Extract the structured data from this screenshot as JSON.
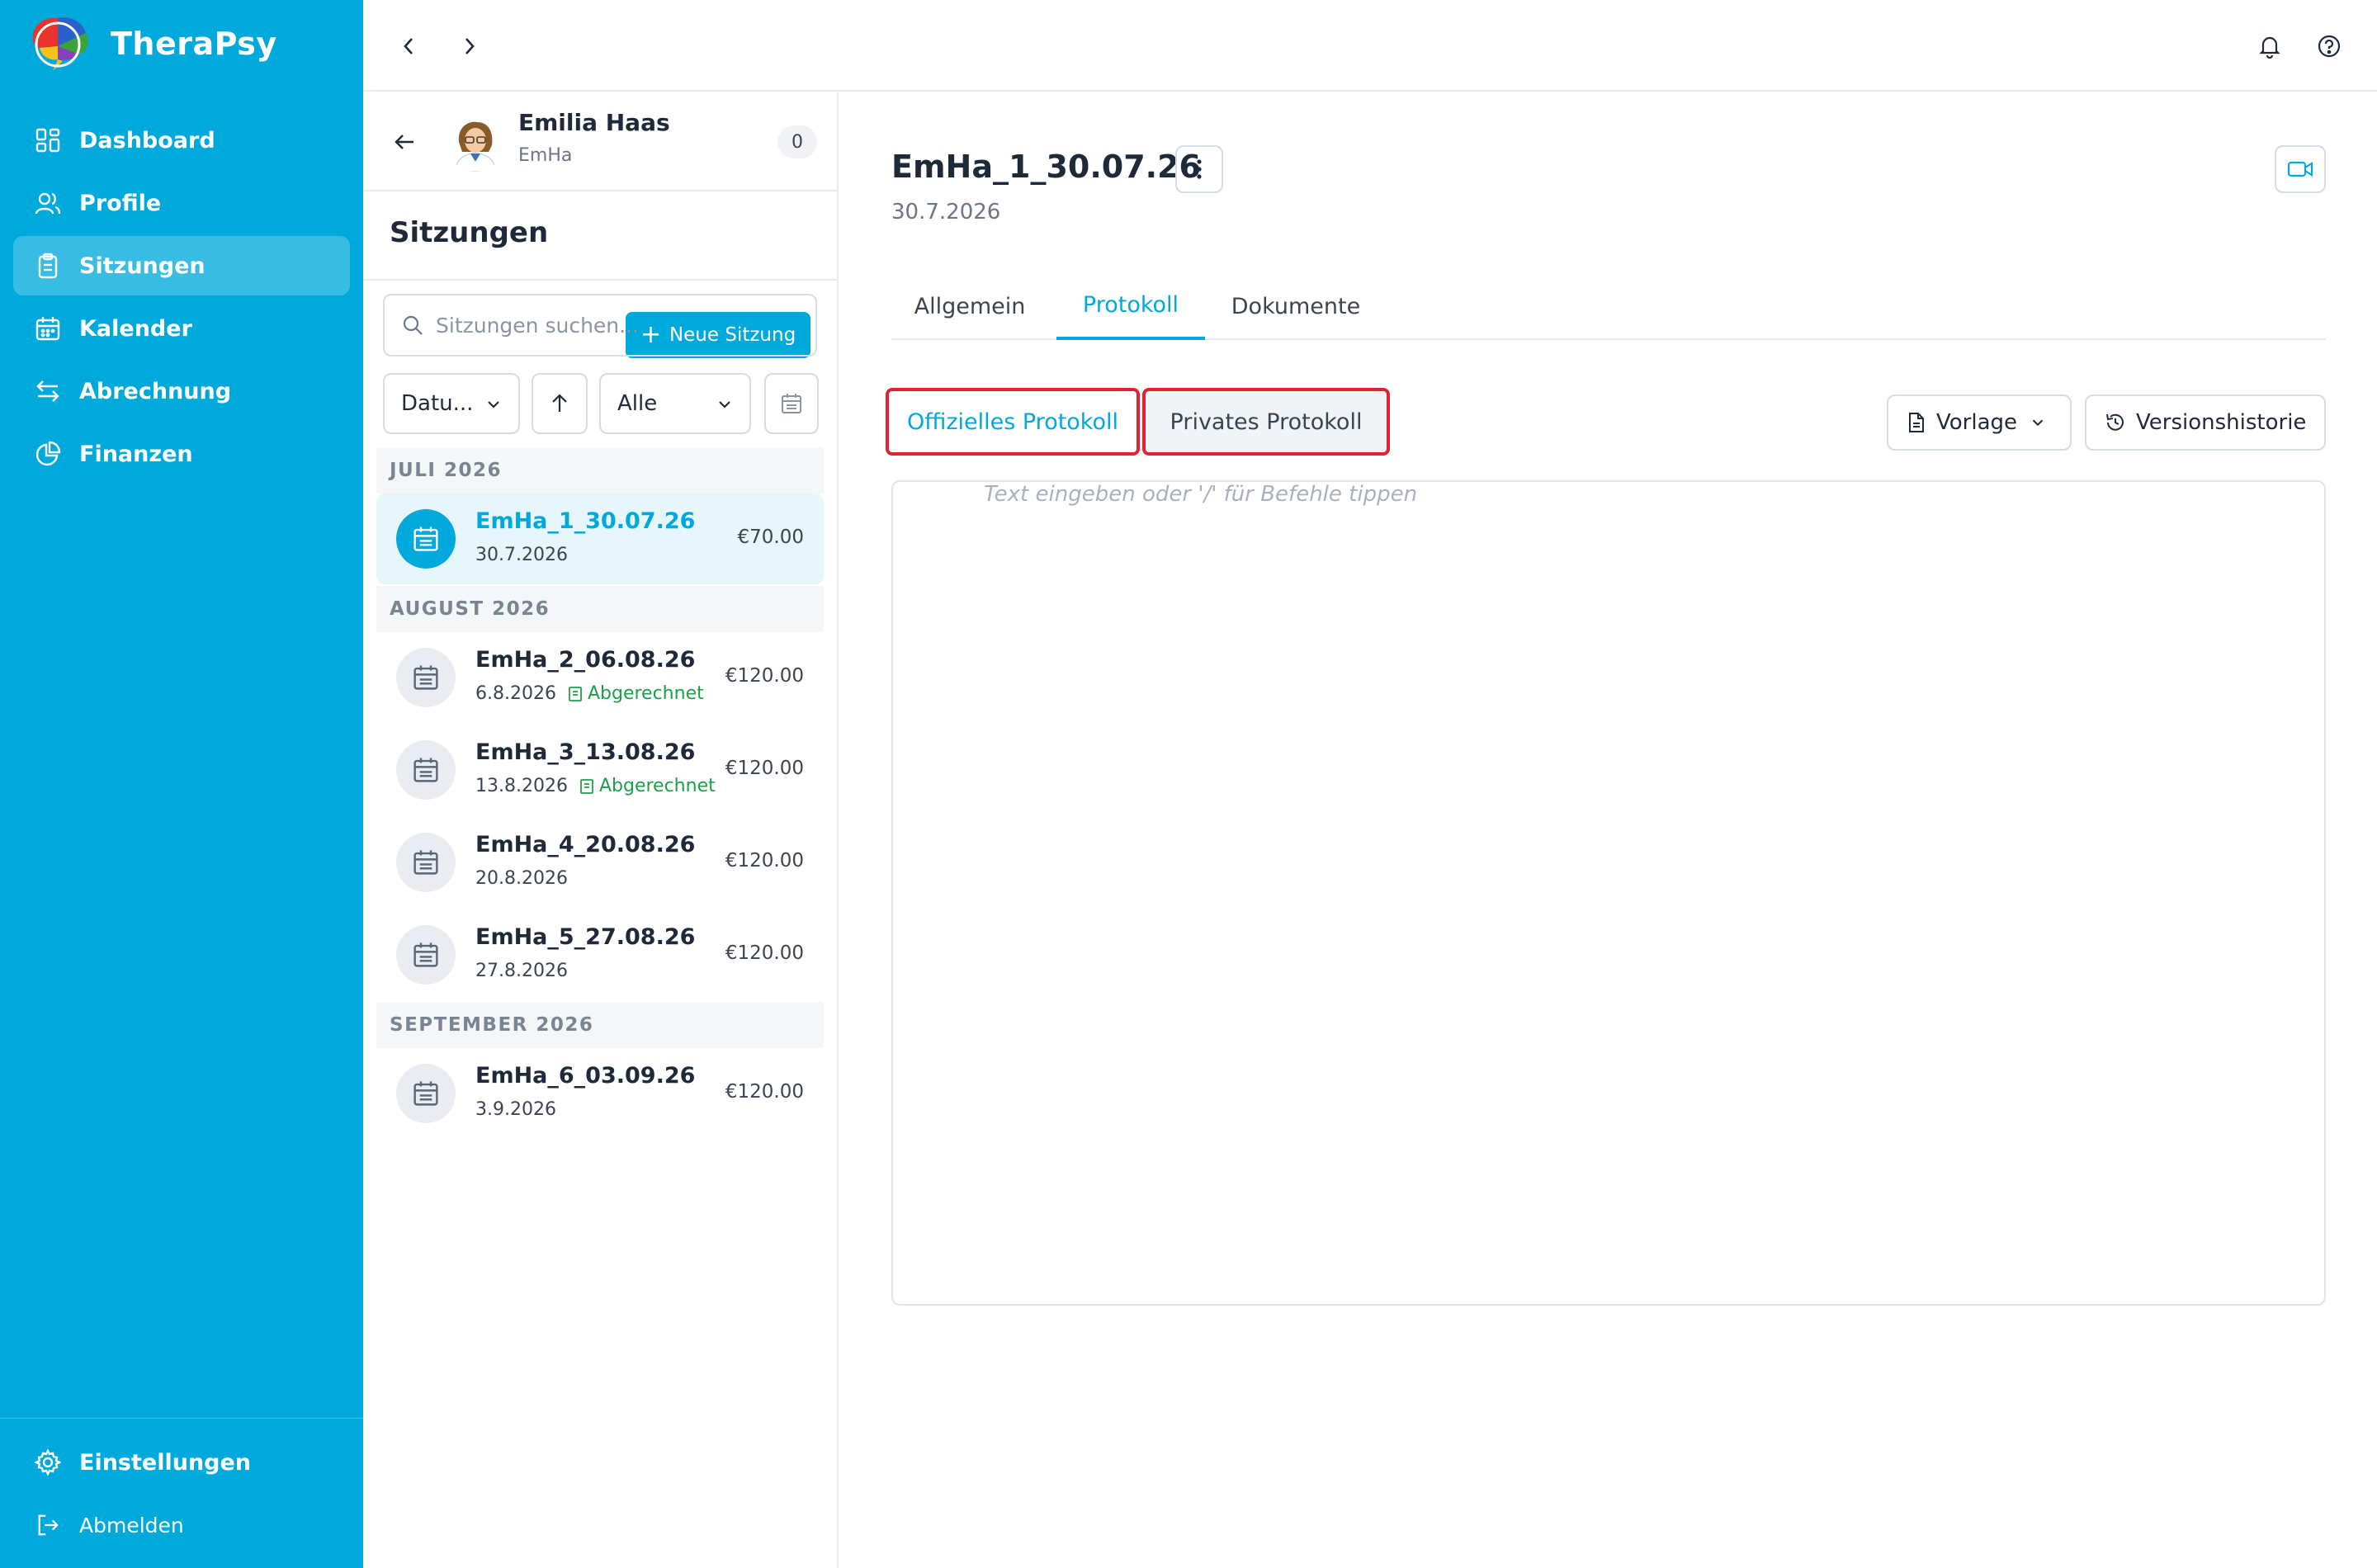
{
  "app": {
    "name": "TheraPsy"
  },
  "sidebar": {
    "items": [
      {
        "label": "Dashboard",
        "icon": "dashboard-icon"
      },
      {
        "label": "Profile",
        "icon": "users-icon"
      },
      {
        "label": "Sitzungen",
        "icon": "clipboard-icon",
        "active": true
      },
      {
        "label": "Kalender",
        "icon": "calendar-icon"
      },
      {
        "label": "Abrechnung",
        "icon": "exchange-icon"
      },
      {
        "label": "Finanzen",
        "icon": "pie-chart-icon"
      }
    ],
    "settings_label": "Einstellungen",
    "logout_label": "Abmelden"
  },
  "patient": {
    "name": "Emilia Haas",
    "short": "EmHa",
    "count": "0"
  },
  "sessions_panel": {
    "title": "Sitzungen",
    "new_button": "Neue Sitzung",
    "search_placeholder": "Sitzungen suchen...",
    "sort_select": "Datu...",
    "filter_select": "Alle",
    "groups": [
      {
        "month": "JULI 2026",
        "items": [
          {
            "name": "EmHa_1_30.07.26",
            "date": "30.7.2026",
            "price": "€70.00",
            "status": "",
            "active": true
          }
        ]
      },
      {
        "month": "AUGUST 2026",
        "items": [
          {
            "name": "EmHa_2_06.08.26",
            "date": "6.8.2026",
            "price": "€120.00",
            "status": "Abgerechnet"
          },
          {
            "name": "EmHa_3_13.08.26",
            "date": "13.8.2026",
            "price": "€120.00",
            "status": "Abgerechnet"
          },
          {
            "name": "EmHa_4_20.08.26",
            "date": "20.8.2026",
            "price": "€120.00",
            "status": ""
          },
          {
            "name": "EmHa_5_27.08.26",
            "date": "27.8.2026",
            "price": "€120.00",
            "status": ""
          }
        ]
      },
      {
        "month": "SEPTEMBER 2026",
        "items": [
          {
            "name": "EmHa_6_03.09.26",
            "date": "3.9.2026",
            "price": "€120.00",
            "status": ""
          }
        ]
      }
    ]
  },
  "main": {
    "title": "EmHa_1_30.07.26",
    "date": "30.7.2026",
    "tabs": [
      "Allgemein",
      "Protokoll",
      "Dokumente"
    ],
    "active_tab": "Protokoll",
    "protocol_toggle": {
      "official": "Offizielles Protokoll",
      "private": "Privates Protokoll"
    },
    "template_button": "Vorlage",
    "history_button": "Versionshistorie",
    "editor_placeholder": "Text eingeben oder '/' für Befehle tippen"
  },
  "colors": {
    "brand": "#00a9dc",
    "highlight": "#e0232f",
    "success": "#1ea04a"
  }
}
